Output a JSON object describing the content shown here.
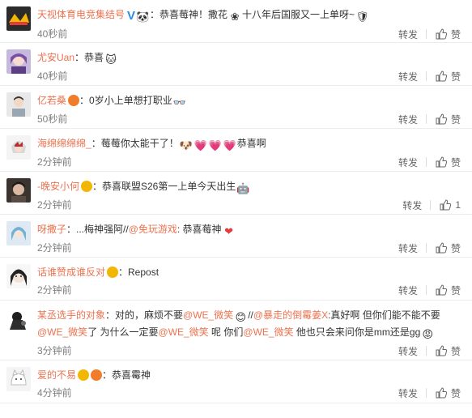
{
  "comments": [
    {
      "user": "天视体育电竞集结号",
      "verified": true,
      "text_prefix": "：恭喜莓神！撒花",
      "text_mid": "十八年后国服又一上单呀~",
      "time": "40秒前",
      "repost": "转发",
      "like": "赞"
    },
    {
      "user": "尤安Uan",
      "text": "：恭喜",
      "time": "40秒前",
      "repost": "转发",
      "like": "赞"
    },
    {
      "user": "亿若桑",
      "text": "：0岁小上单想打职业",
      "time": "50秒前",
      "repost": "转发",
      "like": "赞"
    },
    {
      "user": "海绵绵绵绵_",
      "text_a": "：莓莓你太能干了！",
      "text_b": "恭喜啊",
      "time": "2分钟前",
      "repost": "转发",
      "like": "赞"
    },
    {
      "user": "-晚安小何",
      "text": "：恭喜联盟S26第一上单今天出生",
      "time": "2分钟前",
      "repost": "转发",
      "like": "1"
    },
    {
      "user": "呀撒子",
      "text_a": "：...梅神强阿//",
      "mention": "@免玩游戏",
      "text_b": ": 恭喜莓神",
      "time": "2分钟前",
      "repost": "转发",
      "like": "赞"
    },
    {
      "user": "话谁赞成谁反对",
      "text": "：Repost",
      "time": "2分钟前",
      "repost": "转发",
      "like": "赞"
    },
    {
      "user": "某丞选手的对象",
      "text_a": "：对的，麻烦不要",
      "mention_a": "@WE_微笑",
      "text_b": "//",
      "mention_b": "@暴走的倒霉姜X",
      "text_c": ":真好啊 但你们能不能不要",
      "mention_c": "@WE_微笑",
      "text_d": "了 为什么一定要",
      "mention_d": "@WE_微笑",
      "text_e": " 呢 你们",
      "mention_e": "@WE_微笑",
      "text_f": " 他也只会来问你是mm还是gg",
      "time": "3分钟前",
      "repost": "转发",
      "like": "赞"
    },
    {
      "user": "爱的不易",
      "text": "：恭喜霉神",
      "time": "4分钟前",
      "repost": "转发",
      "like": "赞"
    }
  ],
  "colors": {
    "username": "#eb7350",
    "text": "#333333",
    "meta": "#808080",
    "verified": "#2a8ae8"
  }
}
